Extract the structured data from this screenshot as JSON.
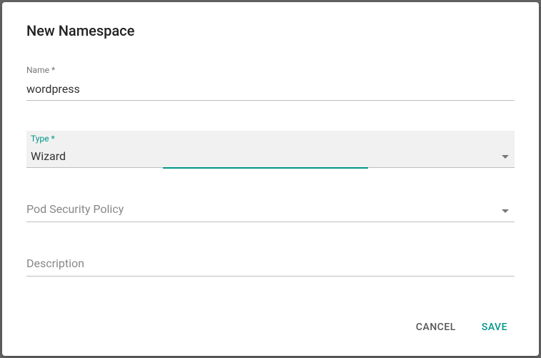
{
  "dialog": {
    "title": "New Namespace",
    "fields": {
      "name": {
        "label": "Name *",
        "value": "wordpress"
      },
      "type": {
        "label": "Type *",
        "value": "Wizard"
      },
      "psp": {
        "placeholder": "Pod Security Policy"
      },
      "description": {
        "placeholder": "Description"
      }
    },
    "actions": {
      "cancel": "CANCEL",
      "save": "SAVE"
    }
  }
}
